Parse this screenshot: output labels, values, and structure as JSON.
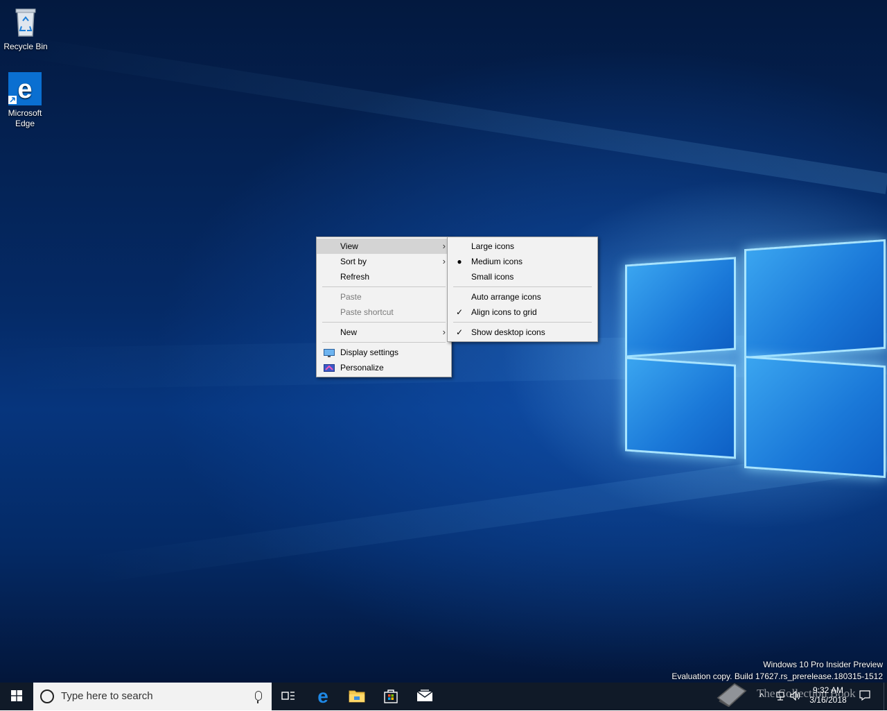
{
  "desktop": {
    "icons": [
      {
        "label": "Recycle Bin"
      },
      {
        "label_line1": "Microsoft",
        "label_line2": "Edge"
      }
    ]
  },
  "context_menu": {
    "items": [
      {
        "label": "View"
      },
      {
        "label": "Sort by"
      },
      {
        "label": "Refresh"
      },
      {
        "label": "Paste"
      },
      {
        "label": "Paste shortcut"
      },
      {
        "label": "New"
      },
      {
        "label": "Display settings"
      },
      {
        "label": "Personalize"
      }
    ]
  },
  "view_submenu": {
    "items": [
      {
        "label": "Large icons"
      },
      {
        "label": "Medium icons",
        "mark": "●"
      },
      {
        "label": "Small icons"
      },
      {
        "label": "Auto arrange icons"
      },
      {
        "label": "Align icons to grid",
        "mark": "✓"
      },
      {
        "label": "Show desktop icons",
        "mark": "✓"
      }
    ]
  },
  "watermark": {
    "line1": "Windows 10 Pro Insider Preview",
    "line2": "Evaluation copy. Build 17627.rs_prerelease.180315-1512"
  },
  "taskbar": {
    "search_placeholder": "Type here to search",
    "time": "9:32 AM",
    "date": "3/16/2018",
    "overlay_text": "The Collection Book"
  },
  "colors": {
    "taskbar": "#101a28",
    "menu_bg": "#f2f2f2",
    "menu_hover": "#d4d4d4",
    "accent": "#0078d7"
  }
}
